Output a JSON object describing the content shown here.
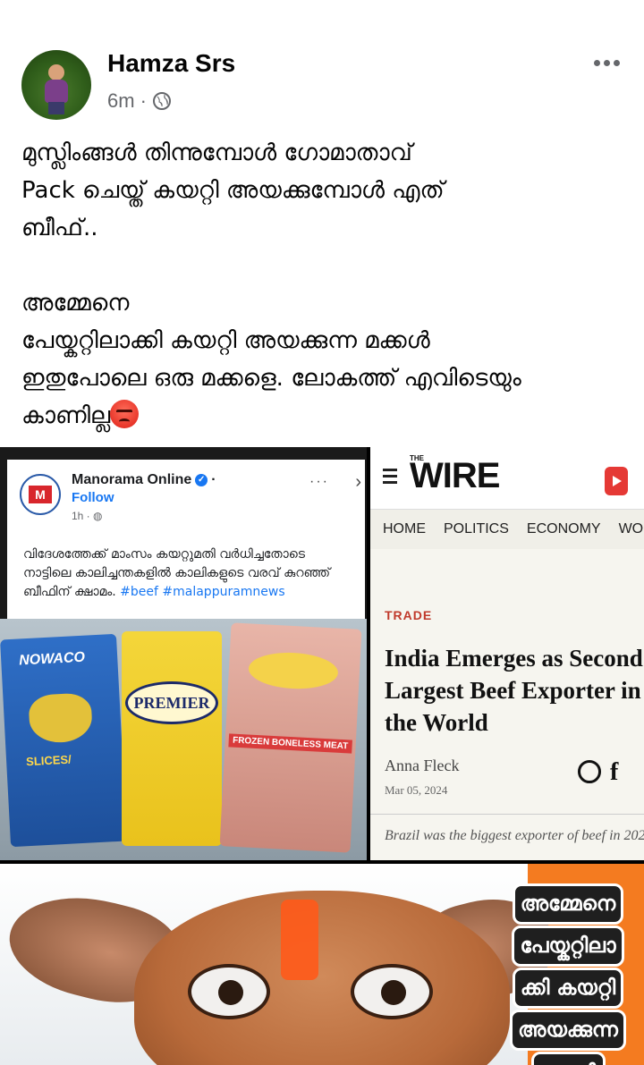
{
  "post": {
    "author": "Hamza Srs",
    "time": "6m",
    "separator": "·",
    "text_lines": [
      "മുസ്ലിംങ്ങൾ തിന്നുമ്പോൾ ഗോമാതാവ്",
      "Pack ചെയ്ത് കയറ്റി അയക്കുമ്പോൾ എത്",
      "ബീഫ്..",
      "",
      "അമ്മേനെ",
      "പേയ്കറ്റിലാക്കി കയറ്റി അയക്കുന്ന മക്കൾ",
      "ഇതുപോലെ ഒരു മക്കളെ. ലോകത്ത് എവിടെയും",
      "കാണില്ല"
    ],
    "emoji": "angry-face"
  },
  "manorama": {
    "page_name": "Manorama Online",
    "follow_label": "Follow",
    "time": "1h ·",
    "dots": "···",
    "chevron": "›",
    "logo_letter": "M",
    "text": "വിദേശത്തേക്ക് മാംസം കയറ്റുമതി വർധിച്ചതോടെ നാട്ടിലെ കാലിച്ചന്തകളിൽ കാലികളുടെ വരവ് കുറഞ്ഞ് ബീഫിന് ക്ഷാമം.",
    "hashtags": "#beef #malappuramnews",
    "packs": {
      "blue_brand": "NOWACO",
      "blue_label": "SLICES/",
      "yellow_brand": "PREMIER",
      "pink_label": "FROZEN BONELESS MEAT"
    }
  },
  "wire": {
    "the": "THE",
    "logo": "WIRE",
    "nav": [
      "HOME",
      "POLITICS",
      "ECONOMY",
      "WORLD"
    ],
    "category": "TRADE",
    "headline": "India Emerges as Second Largest Beef Exporter in the World",
    "author": "Anna Fleck",
    "date": "Mar 05, 2024",
    "facebook": "f",
    "teaser": "Brazil was the biggest exporter of beef in 202"
  },
  "meme": {
    "caption_lines": [
      "അമ്മേനെ",
      "പേയ്കറ്റിലാ",
      "ക്കി കയറ്റി",
      "അയക്കുന്ന",
      "മക്കൾ"
    ]
  }
}
